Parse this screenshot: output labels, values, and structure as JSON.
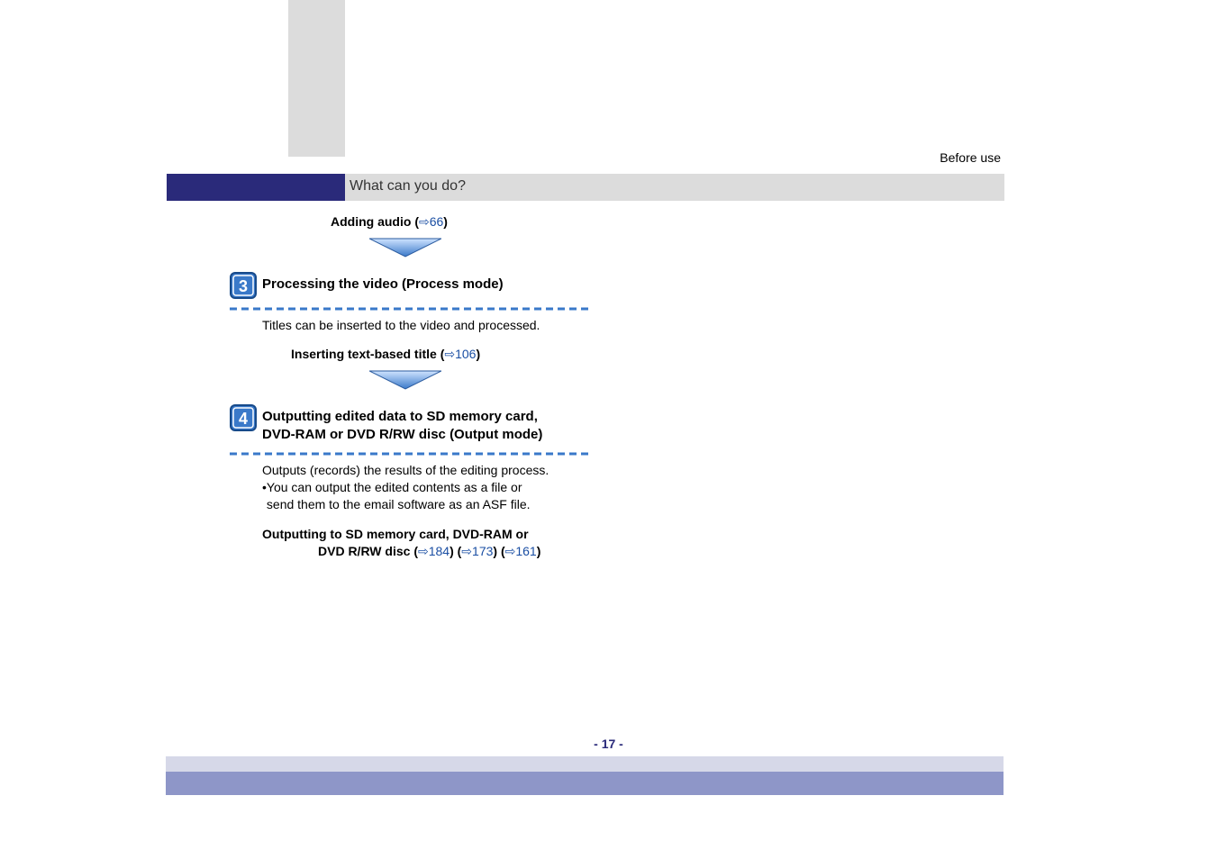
{
  "header": {
    "right_label": "Before use"
  },
  "title_bar": {
    "text": "What can you do?"
  },
  "section_adding_audio": {
    "label_prefix": "Adding audio (",
    "link_num": "66",
    "label_suffix": ")"
  },
  "step3": {
    "number": "3",
    "title": "Processing the video (Process mode)",
    "body": "Titles can be inserted to the video and processed.",
    "sub_prefix": "Inserting text-based title (",
    "sub_link": "106",
    "sub_suffix": ")"
  },
  "step4": {
    "number": "4",
    "title_line1": "Outputting edited data to SD memory card,",
    "title_line2": "DVD-RAM or DVD R/RW disc (Output mode)",
    "body_line1": "Outputs (records) the results of the editing process.",
    "body_bullet": "•",
    "body_line2a": "You can output the edited contents as a file or",
    "body_line2b": "send them to the email software as an ASF file.",
    "sub_line1": "Outputting to SD memory card, DVD-RAM or",
    "sub_line2_prefix": "DVD R/RW disc (",
    "link1": "184",
    "mid1": ") (",
    "link2": "173",
    "mid2": ") (",
    "link3": "161",
    "suffix": ")"
  },
  "footer": {
    "page_number": "- 17 -"
  }
}
